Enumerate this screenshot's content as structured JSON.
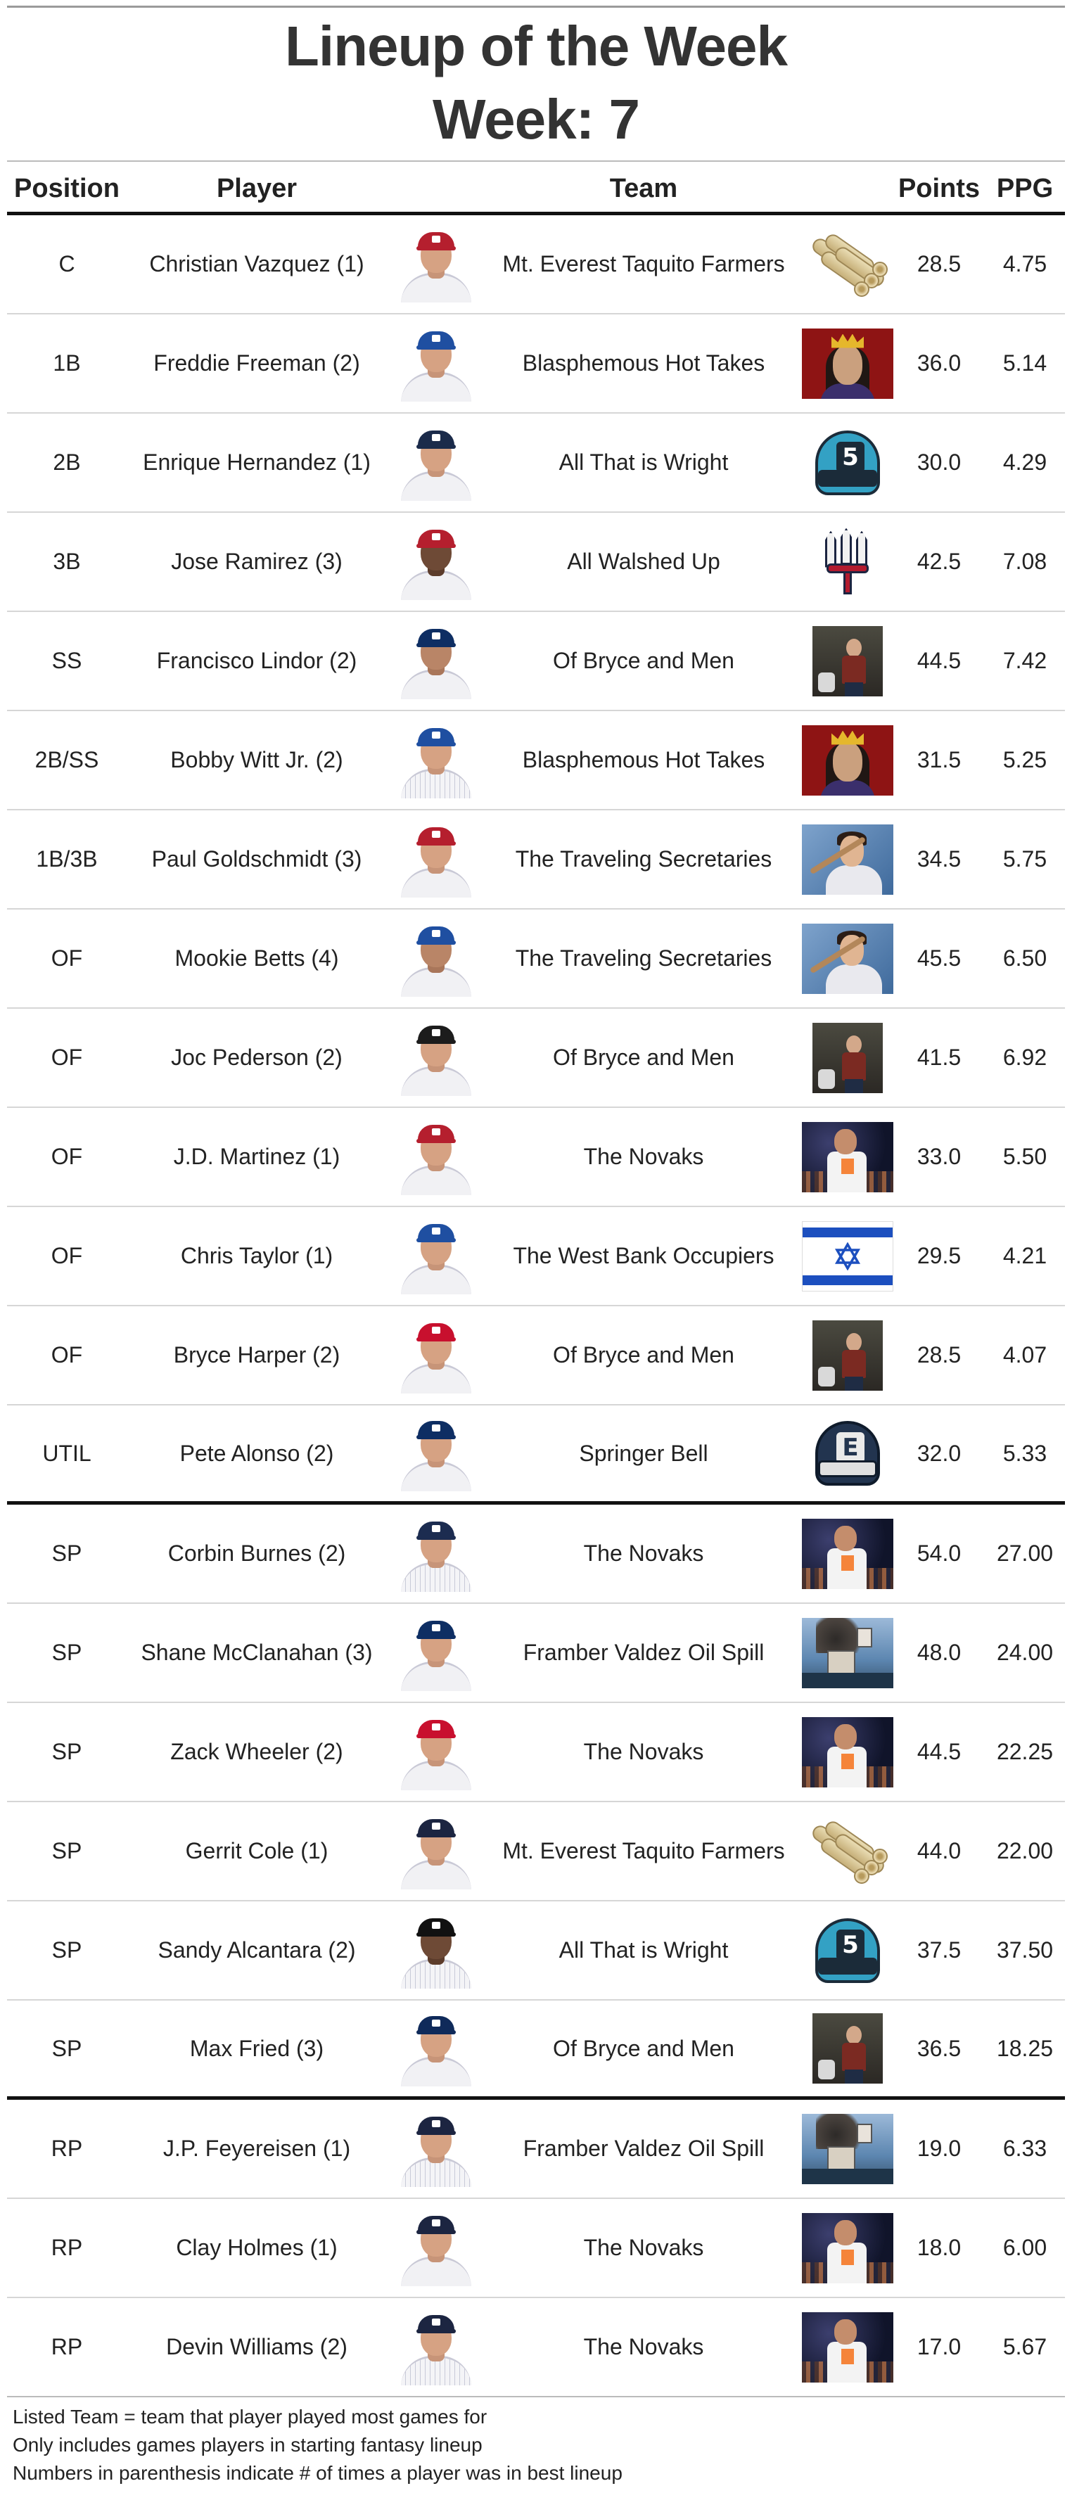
{
  "title": "Lineup of the Week",
  "subtitle": "Week: 7",
  "columns": {
    "position": "Position",
    "player": "Player",
    "team": "Team",
    "points": "Points",
    "ppg": "PPG"
  },
  "rows": [
    {
      "position": "C",
      "player": "Christian Vazquez (1)",
      "team": "Mt. Everest Taquito Farmers",
      "logo": "taquito-logo",
      "points": "28.5",
      "ppg": "4.75"
    },
    {
      "position": "1B",
      "player": "Freddie Freeman (2)",
      "team": "Blasphemous Hot Takes",
      "logo": "blasphemous-logo",
      "points": "36.0",
      "ppg": "5.14"
    },
    {
      "position": "2B",
      "player": "Enrique Hernandez (1)",
      "team": "All That is Wright",
      "logo": "wright-cap-logo",
      "points": "30.0",
      "ppg": "4.29"
    },
    {
      "position": "3B",
      "player": "Jose Ramirez (3)",
      "team": "All Walshed Up",
      "logo": "trident-logo",
      "points": "42.5",
      "ppg": "7.08"
    },
    {
      "position": "SS",
      "player": "Francisco Lindor (2)",
      "team": "Of Bryce and Men",
      "logo": "bryce-logo",
      "points": "44.5",
      "ppg": "7.42"
    },
    {
      "position": "2B/SS",
      "player": "Bobby Witt Jr. (2)",
      "team": "Blasphemous Hot Takes",
      "logo": "blasphemous-logo",
      "points": "31.5",
      "ppg": "5.25"
    },
    {
      "position": "1B/3B",
      "player": "Paul Goldschmidt (3)",
      "team": "The Traveling Secretaries",
      "logo": "traveling-logo",
      "points": "34.5",
      "ppg": "5.75"
    },
    {
      "position": "OF",
      "player": "Mookie Betts (4)",
      "team": "The Traveling Secretaries",
      "logo": "traveling-logo",
      "points": "45.5",
      "ppg": "6.50"
    },
    {
      "position": "OF",
      "player": "Joc Pederson (2)",
      "team": "Of Bryce and Men",
      "logo": "bryce-logo",
      "points": "41.5",
      "ppg": "6.92"
    },
    {
      "position": "OF",
      "player": "J.D. Martinez (1)",
      "team": "The Novaks",
      "logo": "novaks-logo",
      "points": "33.0",
      "ppg": "5.50"
    },
    {
      "position": "OF",
      "player": "Chris Taylor (1)",
      "team": "The West Bank Occupiers",
      "logo": "israel-flag-logo",
      "points": "29.5",
      "ppg": "4.21"
    },
    {
      "position": "OF",
      "player": "Bryce Harper (2)",
      "team": "Of Bryce and Men",
      "logo": "bryce-logo",
      "points": "28.5",
      "ppg": "4.07"
    },
    {
      "position": "UTIL",
      "player": "Pete Alonso (2)",
      "team": "Springer Bell",
      "logo": "springer-cap-logo",
      "points": "32.0",
      "ppg": "5.33"
    },
    {
      "position": "SP",
      "player": "Corbin Burnes (2)",
      "team": "The Novaks",
      "logo": "novaks-logo",
      "points": "54.0",
      "ppg": "27.00"
    },
    {
      "position": "SP",
      "player": "Shane McClanahan (3)",
      "team": "Framber Valdez Oil Spill",
      "logo": "oil-spill-logo",
      "points": "48.0",
      "ppg": "24.00"
    },
    {
      "position": "SP",
      "player": "Zack Wheeler (2)",
      "team": "The Novaks",
      "logo": "novaks-logo",
      "points": "44.5",
      "ppg": "22.25"
    },
    {
      "position": "SP",
      "player": "Gerrit Cole (1)",
      "team": "Mt. Everest Taquito Farmers",
      "logo": "taquito-logo",
      "points": "44.0",
      "ppg": "22.00"
    },
    {
      "position": "SP",
      "player": "Sandy Alcantara (2)",
      "team": "All That is Wright",
      "logo": "wright-cap-logo",
      "points": "37.5",
      "ppg": "37.50"
    },
    {
      "position": "SP",
      "player": "Max Fried (3)",
      "team": "Of Bryce and Men",
      "logo": "bryce-logo",
      "points": "36.5",
      "ppg": "18.25"
    },
    {
      "position": "RP",
      "player": "J.P. Feyereisen (1)",
      "team": "Framber Valdez Oil Spill",
      "logo": "oil-spill-logo",
      "points": "19.0",
      "ppg": "6.33"
    },
    {
      "position": "RP",
      "player": "Clay Holmes (1)",
      "team": "The Novaks",
      "logo": "novaks-logo",
      "points": "18.0",
      "ppg": "6.00"
    },
    {
      "position": "RP",
      "player": "Devin Williams (2)",
      "team": "The Novaks",
      "logo": "novaks-logo",
      "points": "17.0",
      "ppg": "5.67"
    }
  ],
  "footnotes": [
    "Listed Team = team that player played most games for",
    "Only includes games players in starting fantasy lineup",
    "Numbers in parenthesis indicate # of times a player was in best lineup"
  ]
}
